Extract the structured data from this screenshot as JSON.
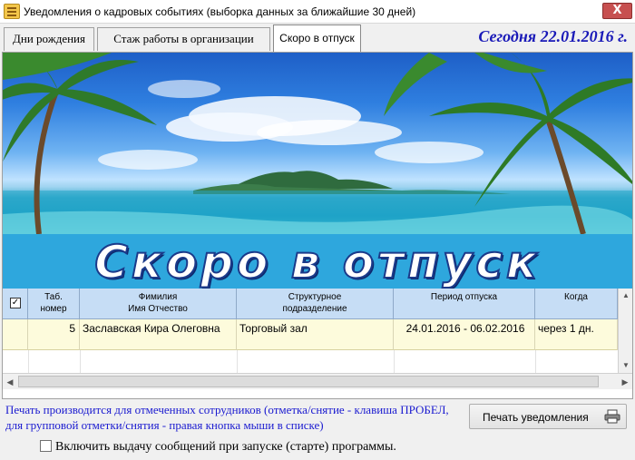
{
  "window": {
    "title": "Уведомления о кадровых событиях (выборка данных за ближайшие 30 дней)",
    "close_label": "X"
  },
  "tabs": [
    {
      "label": "Дни рождения",
      "active": false
    },
    {
      "label": "Стаж работы в организации",
      "active": false
    },
    {
      "label": "Скоро в отпуск",
      "active": true
    }
  ],
  "today_label": "Сегодня 22.01.2016 г.",
  "banner": {
    "headline": "Скоро в отпуск"
  },
  "table": {
    "columns": [
      {
        "key": "check",
        "label": ""
      },
      {
        "key": "tab_no",
        "label_line1": "Таб.",
        "label_line2": "номер"
      },
      {
        "key": "name",
        "label_line1": "Фимилия",
        "label_line2": "Имя Отчество"
      },
      {
        "key": "dept",
        "label_line1": "Структурное",
        "label_line2": "подразделение"
      },
      {
        "key": "period",
        "label_line1": "Период отпуска",
        "label_line2": ""
      },
      {
        "key": "when",
        "label_line1": "Когда",
        "label_line2": ""
      }
    ],
    "header_checked": true,
    "rows": [
      {
        "checked": false,
        "tab_no": "5",
        "name": "Заславская Кира Олеговна",
        "dept": "Торговый зал",
        "period": "24.01.2016 - 06.02.2016",
        "when": "через 1 дн."
      }
    ]
  },
  "hint_text": "Печать производится для отмеченных сотрудников (отметка/снятие - клавиша ПРОБЕЛ, для групповой отметки/снятия - правая кнопка мыши в списке)",
  "print_button_label": "Печать уведомления",
  "startup_checkbox": {
    "label": "Включить выдачу сообщений при запуске (старте) программы.",
    "checked": false
  },
  "colors": {
    "accent_blue": "#1a1ad0",
    "header_bg": "#c6ddf5",
    "row_bg": "#fdfbdc",
    "headline_bg": "#2ea7dd"
  }
}
